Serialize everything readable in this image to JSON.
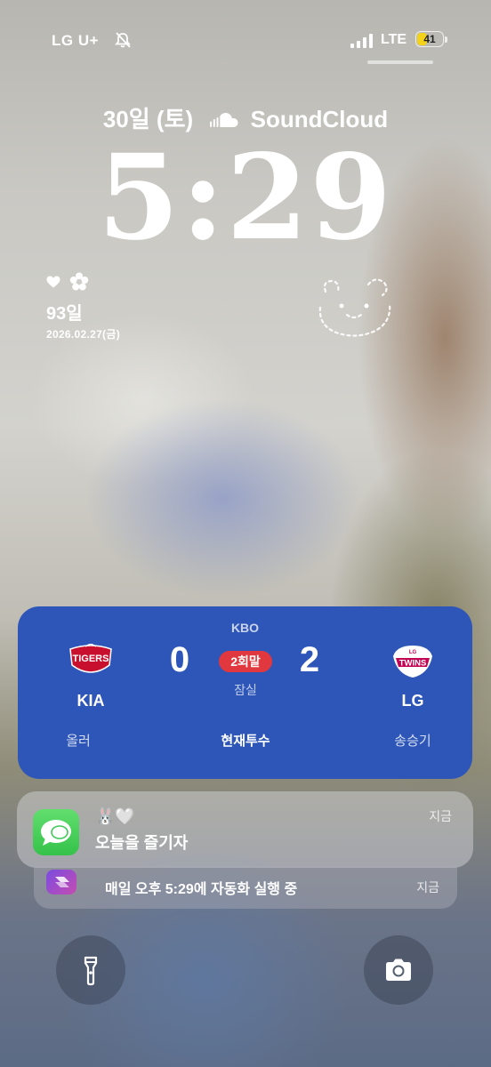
{
  "status_bar": {
    "carrier": "LG U+",
    "network": "LTE",
    "battery_percent": "41",
    "battery_level": 0.41
  },
  "lock_screen": {
    "date_text": "30일 (토)",
    "widget_app": "SoundCloud",
    "time": "5:29"
  },
  "dday_widget": {
    "days": "93일",
    "date": "2026.02.27(금)"
  },
  "kbo_activity": {
    "league": "KBO",
    "home_team": {
      "name": "KIA",
      "logo_text": "TIGERS",
      "score": "0",
      "pitcher": "올러",
      "color": "#c8102e"
    },
    "away_team": {
      "name": "LG",
      "logo_text": "TWINS",
      "logo_small": "LG",
      "score": "2",
      "pitcher": "송승기",
      "color": "#c30452"
    },
    "inning": "2회말",
    "stadium": "잠실",
    "pitcher_label": "현재투수",
    "background": "#2d56b8"
  },
  "notifications": [
    {
      "app": "messages",
      "title": "🐰🤍",
      "body": "오늘을 즐기자",
      "time": "지금"
    },
    {
      "app": "shortcuts",
      "body": "매일 오후 5:29에 자동화 실행 중",
      "time": "지금"
    }
  ],
  "quick_actions": {
    "left": "flashlight-icon",
    "right": "camera-icon"
  }
}
